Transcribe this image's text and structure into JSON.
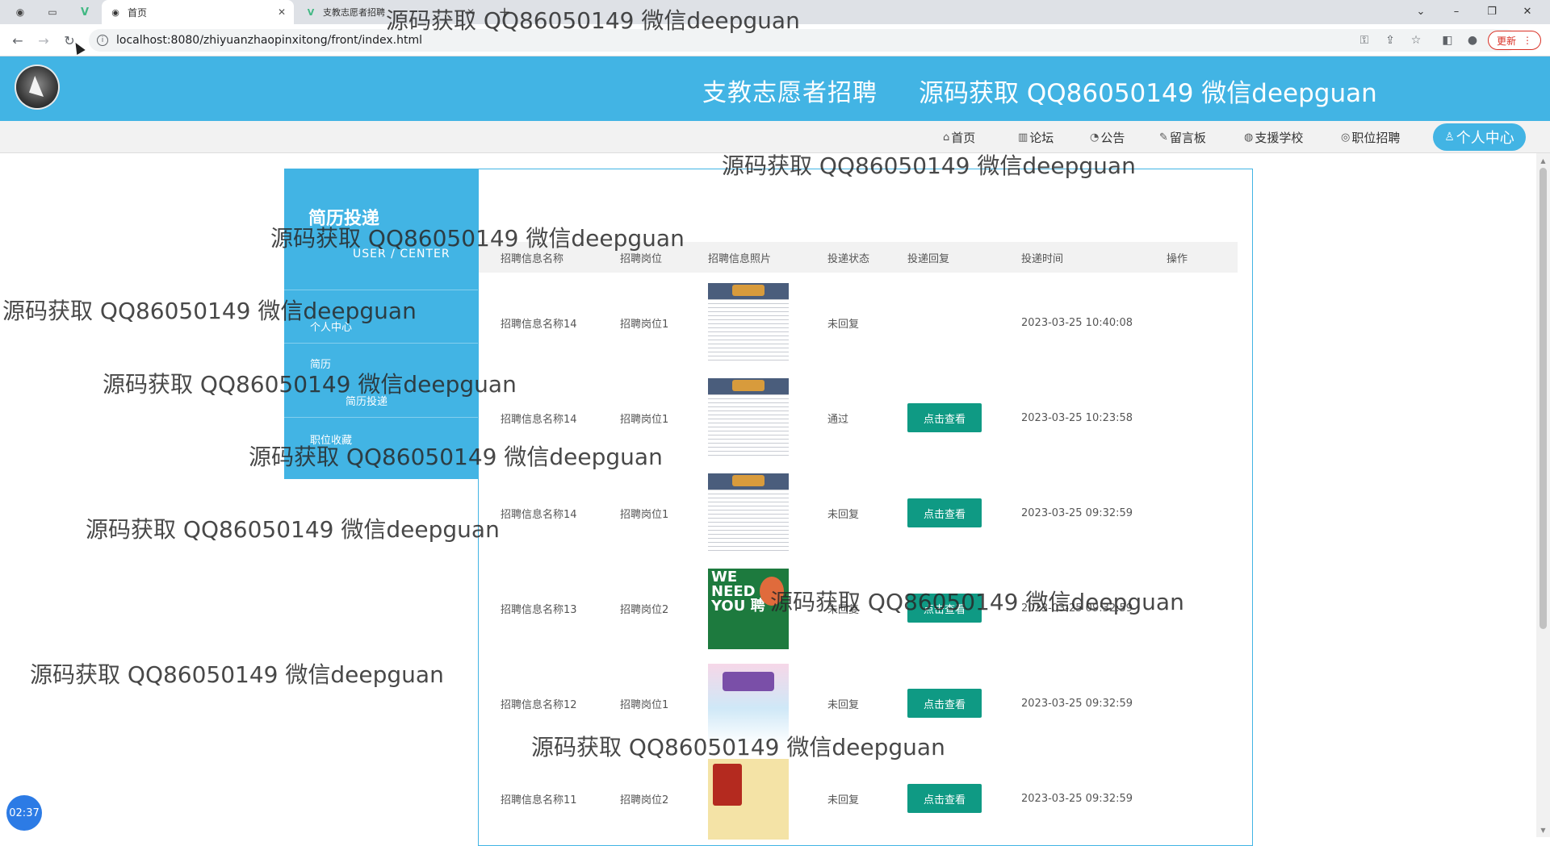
{
  "browser": {
    "tabs": [
      {
        "label": "首页",
        "icon": "globe-icon"
      },
      {
        "label": "支教志愿者招聘",
        "icon": "vue-logo-icon"
      }
    ],
    "url": "localhost:8080/zhiyuanzhaopinxitong/front/index.html",
    "update_label": "更新"
  },
  "site": {
    "title": "支教志愿者招聘",
    "header_watermark": "源码获取 QQ86050149 微信deepguan"
  },
  "menu": {
    "items": [
      {
        "icon": "⌂",
        "label": "首页"
      },
      {
        "icon": "▥",
        "label": "论坛"
      },
      {
        "icon": "◔",
        "label": "公告"
      },
      {
        "icon": "✎",
        "label": "留言板"
      },
      {
        "icon": "◍",
        "label": "支援学校"
      },
      {
        "icon": "◎",
        "label": "职位招聘"
      }
    ],
    "center_label": "个人中心"
  },
  "sidebar": {
    "title": "简历投递",
    "subtitle": "USER / CENTER",
    "items": [
      "个人中心",
      "简历",
      "简历投递",
      "职位收藏"
    ]
  },
  "table": {
    "headers": [
      "招聘信息名称",
      "招聘岗位",
      "招聘信息照片",
      "投递状态",
      "投递回复",
      "投递时间",
      "操作"
    ],
    "view_label": "点击查看",
    "rows": [
      {
        "name": "招聘信息名称14",
        "post": "招聘岗位1",
        "photo": "poster-a",
        "status": "未回复",
        "has_reply": false,
        "time": "2023-03-25 10:40:08"
      },
      {
        "name": "招聘信息名称14",
        "post": "招聘岗位1",
        "photo": "poster-a",
        "status": "通过",
        "has_reply": true,
        "time": "2023-03-25 10:23:58"
      },
      {
        "name": "招聘信息名称14",
        "post": "招聘岗位1",
        "photo": "poster-a",
        "status": "未回复",
        "has_reply": true,
        "time": "2023-03-25 09:32:59"
      },
      {
        "name": "招聘信息名称13",
        "post": "招聘岗位2",
        "photo": "poster-b",
        "status": "未回复",
        "has_reply": true,
        "time": "2023-03-25 09:32:59"
      },
      {
        "name": "招聘信息名称12",
        "post": "招聘岗位1",
        "photo": "poster-c",
        "status": "未回复",
        "has_reply": true,
        "time": "2023-03-25 09:32:59"
      },
      {
        "name": "招聘信息名称11",
        "post": "招聘岗位2",
        "photo": "poster-d",
        "status": "未回复",
        "has_reply": true,
        "time": "2023-03-25 09:32:59"
      }
    ]
  },
  "overlay": {
    "timer": "02:37",
    "watermark": "源码获取 QQ86050149 微信deepguan"
  },
  "poster_text": {
    "b": "WE NEED YOU 聘"
  },
  "colors": {
    "brand": "#42b4e4",
    "button": "#0f9a84"
  }
}
